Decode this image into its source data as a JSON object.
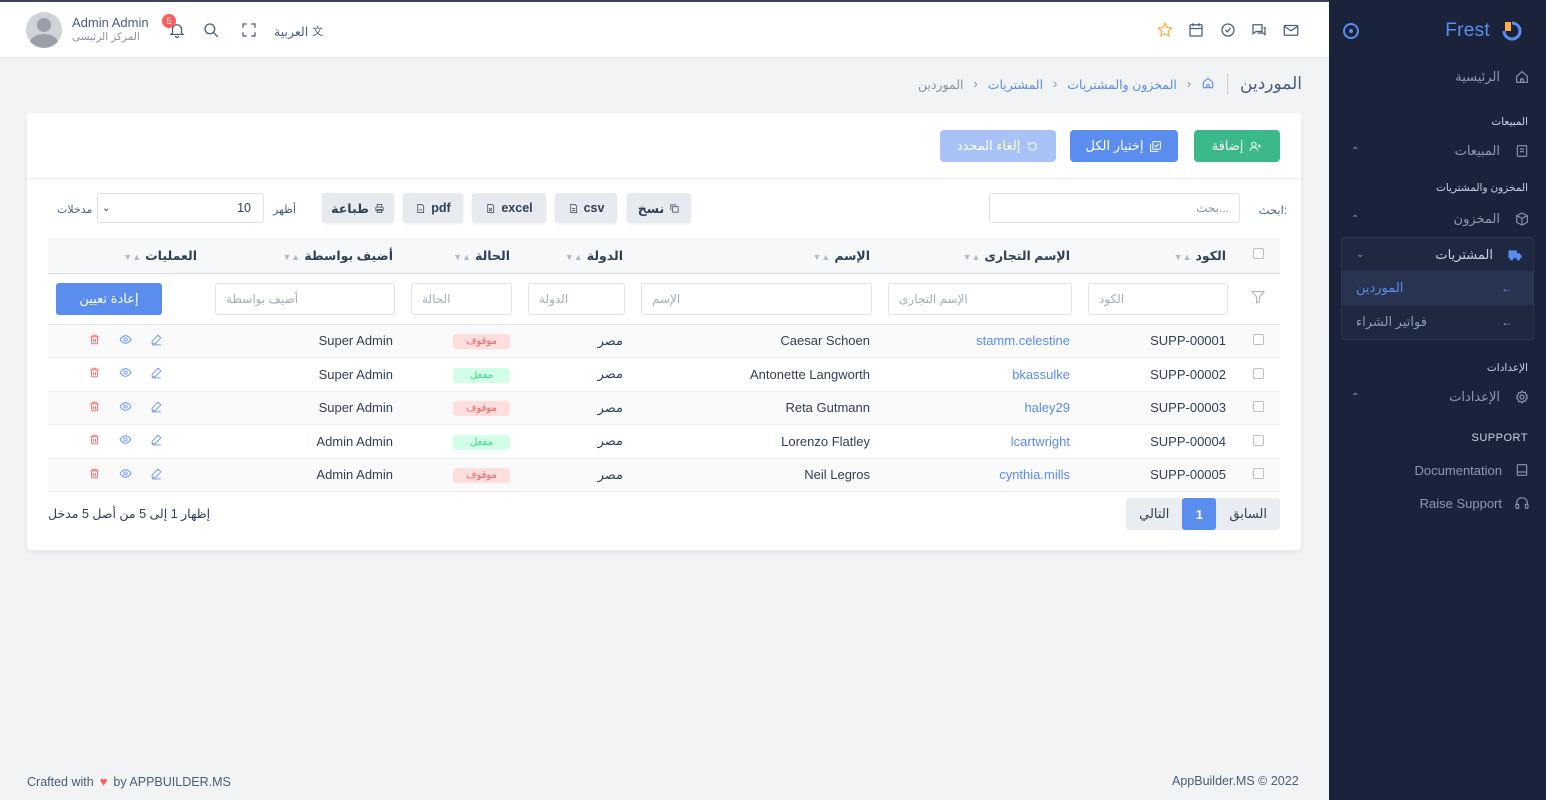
{
  "app": {
    "brand": "Frest"
  },
  "topbar": {
    "user_name": "Admin Admin",
    "user_role": "المركز الرئيسى",
    "notifications": "5",
    "language": "العربية"
  },
  "sidebar": {
    "home": "الرئيسية",
    "header_sales": "المبيعات",
    "sales": "المبيعات",
    "header_inventory": "المخزون والمشتريات",
    "inventory": "المخزون",
    "purchases": "المشتريات",
    "suppliers": "الموردين",
    "purchase_invoices": "فواتير الشراء",
    "header_settings": "الإعدادات",
    "settings": "الإعدادات",
    "header_support": "SUPPORT",
    "documentation": "Documentation",
    "raise_support": "Raise Support"
  },
  "page": {
    "title": "الموردين",
    "breadcrumb": [
      "المخزون والمشتريات",
      "المشتريات",
      "الموردين"
    ]
  },
  "actions": {
    "add": "إضافة",
    "select_all": "إختيار الكل",
    "cancel_selected": "إلغاء المحدد"
  },
  "tools": {
    "search_label": "ابحث:",
    "search_placeholder": "بحث...",
    "copy": "نسخ",
    "csv": "csv",
    "excel": "excel",
    "pdf": "pdf",
    "print": "طباعة",
    "show_label": "أظهر",
    "page_size": "10",
    "entries_label": "مدخلات"
  },
  "table": {
    "headers": {
      "code": "الكود",
      "trade_name": "الإسم التجارى",
      "name": "الإسم",
      "country": "الدولة",
      "status": "الحالة",
      "added_by": "أضيف بواسطة",
      "operations": "العمليات"
    },
    "filters": {
      "code": "الكود",
      "trade_name": "الإسم التجارى",
      "name": "الإسم",
      "country": "الدولة",
      "status": "الحالة",
      "added_by": "أضيف بواسطة",
      "reset": "إعادة تعيين"
    },
    "rows": [
      {
        "code": "SUPP-00001",
        "trade_name": "stamm.celestine",
        "name": "Caesar Schoen",
        "country": "مصر",
        "status": "موقوف",
        "status_type": "off",
        "added_by": "Super Admin"
      },
      {
        "code": "SUPP-00002",
        "trade_name": "bkassulke",
        "name": "Antonette Langworth",
        "country": "مصر",
        "status": "مفعل",
        "status_type": "on",
        "added_by": "Super Admin"
      },
      {
        "code": "SUPP-00003",
        "trade_name": "haley29",
        "name": "Reta Gutmann",
        "country": "مصر",
        "status": "موقوف",
        "status_type": "off",
        "added_by": "Super Admin"
      },
      {
        "code": "SUPP-00004",
        "trade_name": "lcartwright",
        "name": "Lorenzo Flatley",
        "country": "مصر",
        "status": "مفعل",
        "status_type": "on",
        "added_by": "Admin Admin"
      },
      {
        "code": "SUPP-00005",
        "trade_name": "cynthia.mills",
        "name": "Neil Legros",
        "country": "مصر",
        "status": "موقوف",
        "status_type": "off",
        "added_by": "Admin Admin"
      }
    ]
  },
  "pagination": {
    "info": "إظهار 1 إلى 5 من أصل 5 مدخل",
    "prev": "السابق",
    "current": "1",
    "next": "التالي"
  },
  "footer": {
    "crafted_prefix": "Crafted with",
    "crafted_suffix": "by APPBUILDER.MS",
    "copyright": "AppBuilder.MS © 2022"
  },
  "colors": {
    "primary": "#5a8dee",
    "success": "#39da8a",
    "danger": "#ff5b5c",
    "sidebar_bg": "#1a233a"
  }
}
